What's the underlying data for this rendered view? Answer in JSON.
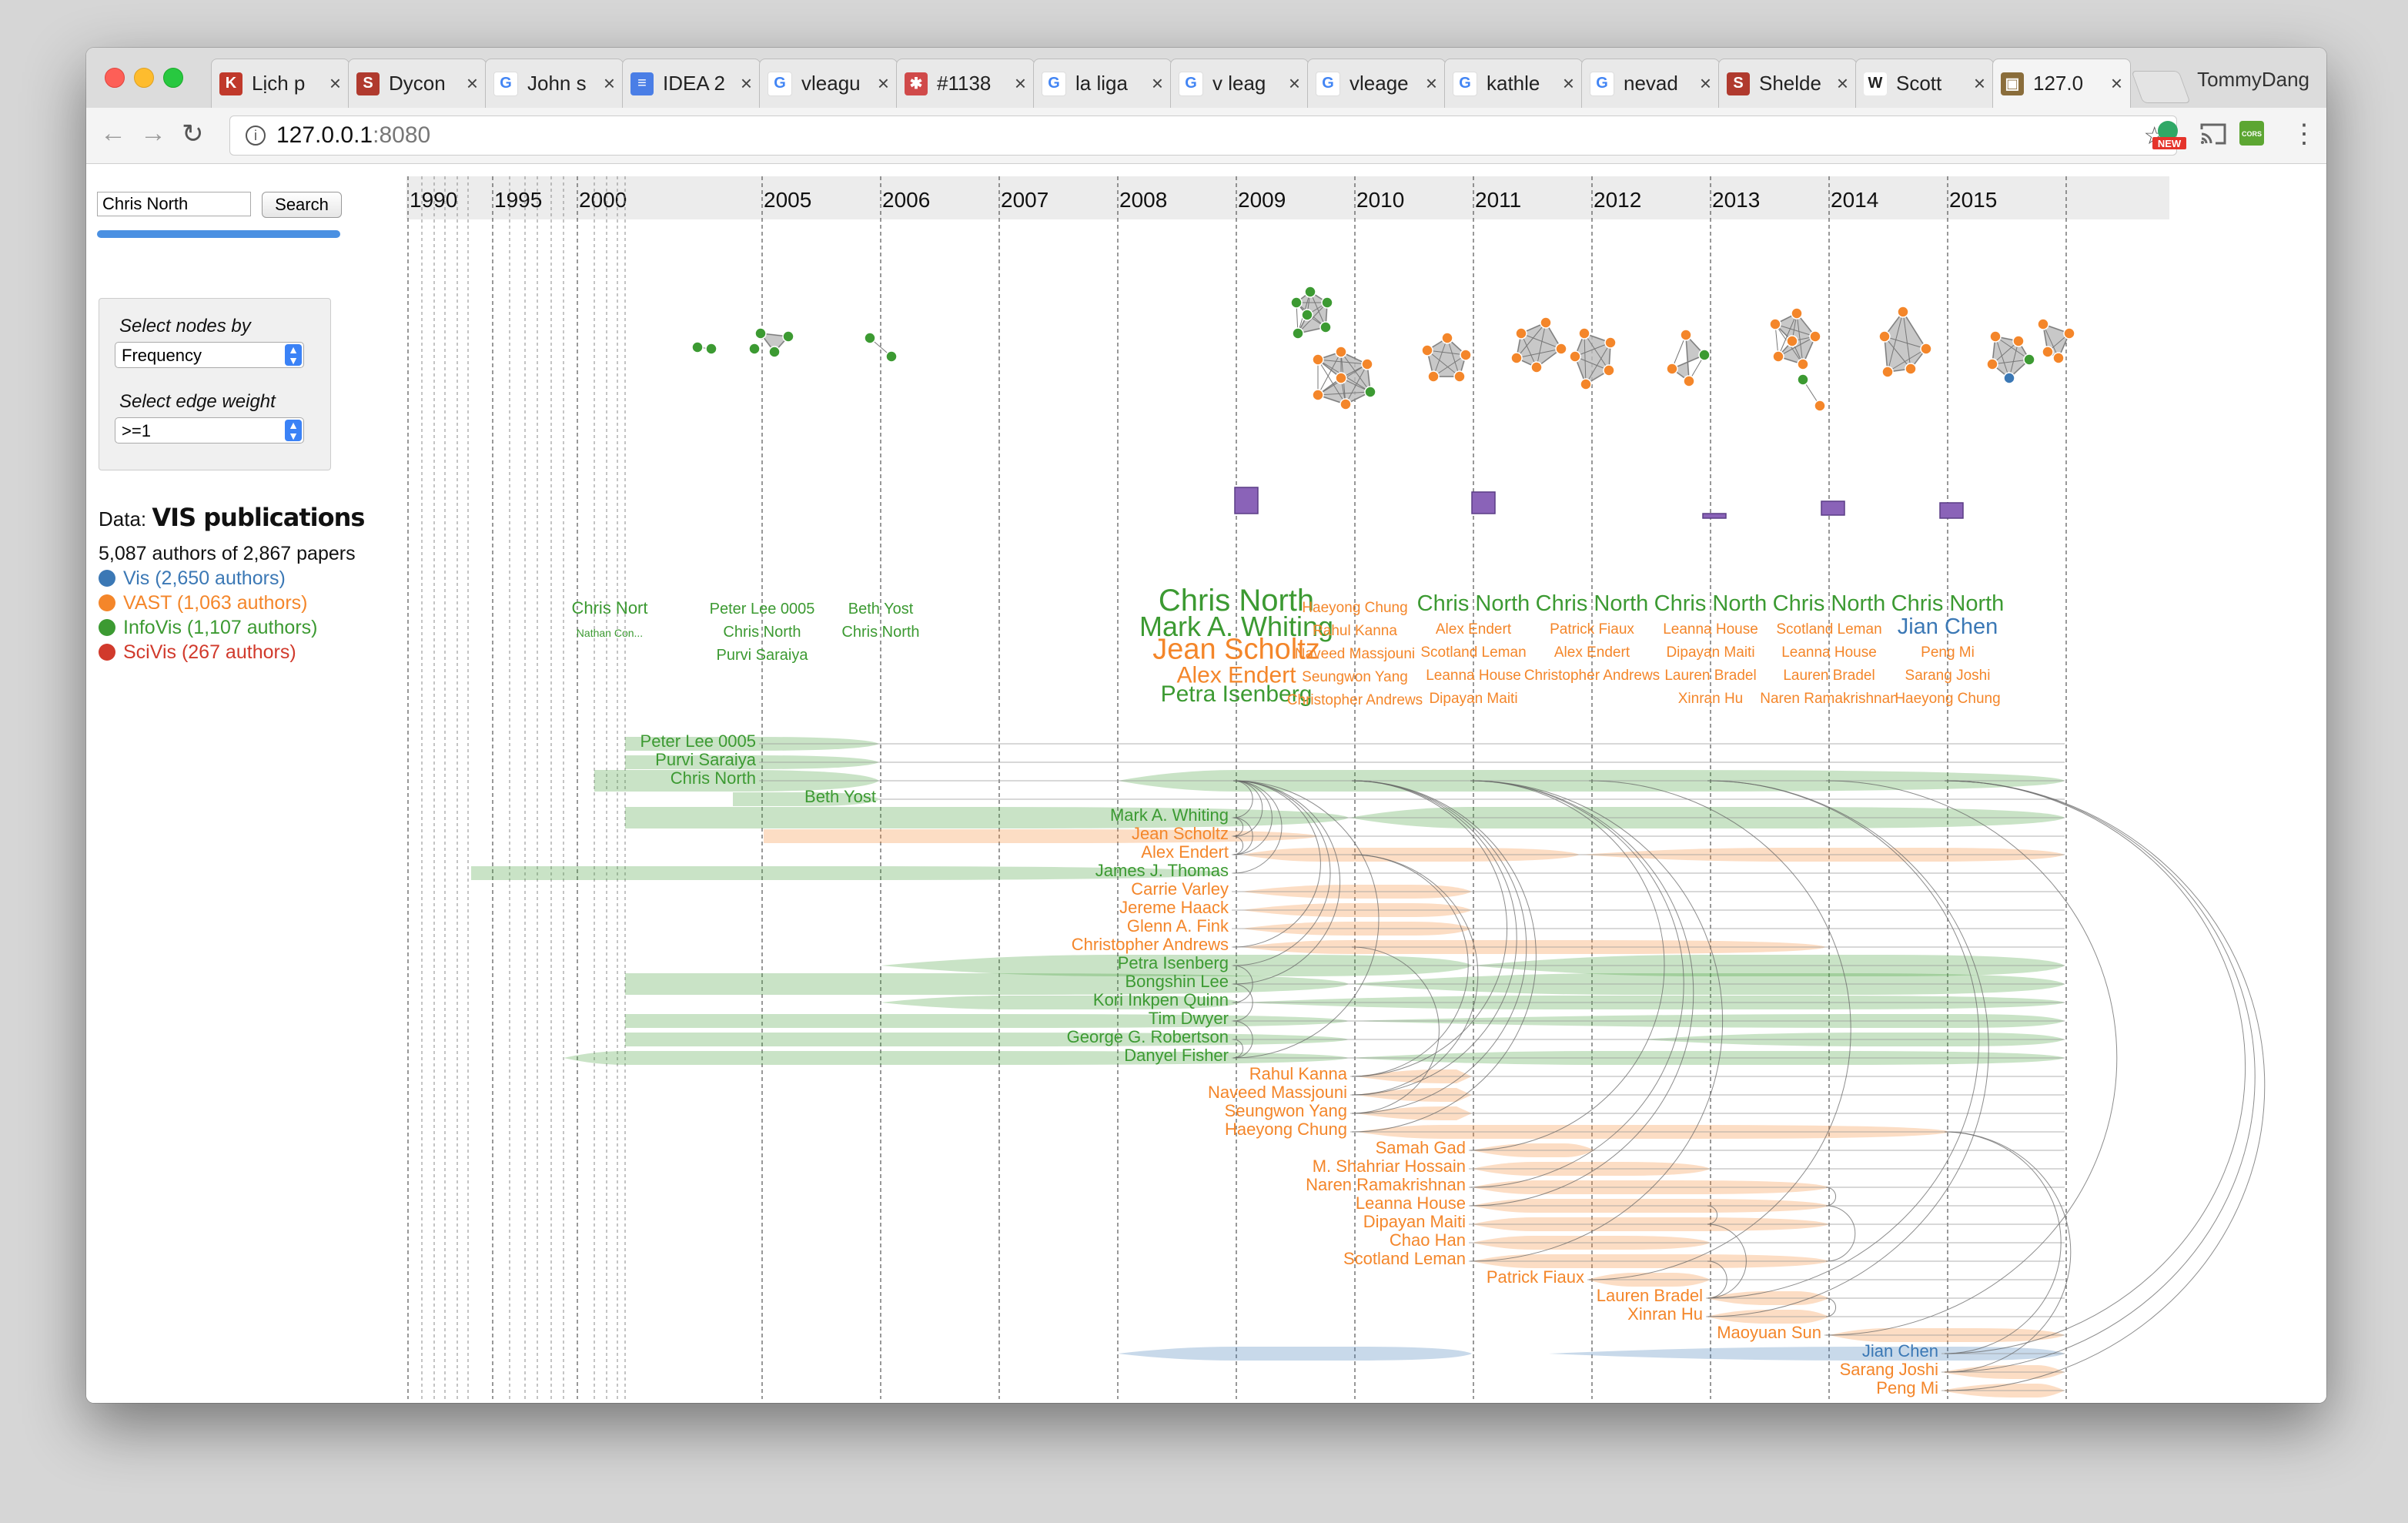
{
  "browser": {
    "profile_name": "TommyDang",
    "tabs": [
      {
        "label": "Lịch p",
        "icon": "k-news-icon",
        "color": "#c0392b"
      },
      {
        "label": "Dycon",
        "icon": "s-icon",
        "color": "#b03a2e"
      },
      {
        "label": "John s",
        "icon": "google-icon",
        "color": "#4285f4"
      },
      {
        "label": "IDEA 2",
        "icon": "docs-icon",
        "color": "#4a7ee6"
      },
      {
        "label": "vleagu",
        "icon": "google-icon",
        "color": "#4285f4"
      },
      {
        "label": "#1138",
        "icon": "slack-icon",
        "color": "#d04a4a"
      },
      {
        "label": "la liga",
        "icon": "google-icon",
        "color": "#4285f4"
      },
      {
        "label": "v leag",
        "icon": "google-icon",
        "color": "#4285f4"
      },
      {
        "label": "vleage",
        "icon": "google-icon",
        "color": "#4285f4"
      },
      {
        "label": "kathle",
        "icon": "google-icon",
        "color": "#4285f4"
      },
      {
        "label": "nevad",
        "icon": "google-icon",
        "color": "#4285f4"
      },
      {
        "label": "Shelde",
        "icon": "s-icon",
        "color": "#b03a2e"
      },
      {
        "label": "Scott",
        "icon": "wikipedia-icon",
        "color": "#222222"
      },
      {
        "label": "127.0",
        "icon": "photo-icon",
        "color": "#8a6d3b"
      }
    ],
    "url_host": "127.0.0.1",
    "url_port": ":8080",
    "ext_new_badge": "NEW",
    "ext_cors_badge": "CORS"
  },
  "sidebar": {
    "search_value": "Chris North",
    "search_button": "Search",
    "select_nodes_label": "Select nodes by",
    "select_nodes_value": "Frequency",
    "select_edge_label": "Select edge weight",
    "select_edge_value": ">=1",
    "data_prefix": "Data:",
    "data_name": "VIS publications",
    "counts": "5,087 authors of 2,867 papers",
    "legend": [
      {
        "label": "Vis (2,650 authors)",
        "color": "#3b78b5"
      },
      {
        "label": "VAST (1,063 authors)",
        "color": "#f4862a"
      },
      {
        "label": "InfoVis (1,107 authors)",
        "color": "#3c9a32"
      },
      {
        "label": "SciVis (267 authors)",
        "color": "#d13a2c"
      }
    ]
  },
  "timeline": {
    "years": [
      "1990",
      "1995",
      "2000",
      "2005",
      "2006",
      "2007",
      "2008",
      "2009",
      "2010",
      "2011",
      "2012",
      "2013",
      "2014",
      "2015"
    ],
    "colors": {
      "green": "#3c9a32",
      "orange": "#f4862a",
      "blue": "#3b78b5",
      "purple": "#8a63b8",
      "grey": "#888888"
    },
    "year_clusters": [
      {
        "names": [
          {
            "t": "Chris Nort",
            "c": "green"
          },
          {
            "t": "Nathan Con...",
            "c": "green"
          }
        ]
      },
      {
        "names": [
          {
            "t": "Peter Lee 0005",
            "c": "green"
          },
          {
            "t": "Chris North",
            "c": "green"
          },
          {
            "t": "Purvi Saraiya",
            "c": "green"
          }
        ]
      },
      {
        "names": [
          {
            "t": "Beth Yost",
            "c": "green"
          },
          {
            "t": "Chris North",
            "c": "green"
          }
        ]
      },
      {
        "names": [
          {
            "t": "Chris North",
            "c": "green"
          },
          {
            "t": "Mark A. Whiting",
            "c": "green"
          },
          {
            "t": "Jean Scholtz",
            "c": "orange"
          },
          {
            "t": "Alex Endert",
            "c": "orange"
          },
          {
            "t": "Petra Isenberg",
            "c": "green"
          }
        ]
      },
      {
        "names": [
          {
            "t": "Haeyong Chung",
            "c": "orange"
          },
          {
            "t": "Rahul Kanna",
            "c": "orange"
          },
          {
            "t": "Naveed Massjouni",
            "c": "orange"
          },
          {
            "t": "Seungwon Yang",
            "c": "orange"
          },
          {
            "t": "Christopher Andrews",
            "c": "orange"
          }
        ]
      },
      {
        "names": [
          {
            "t": "Chris North",
            "c": "green"
          },
          {
            "t": "Alex Endert",
            "c": "orange"
          },
          {
            "t": "Scotland Leman",
            "c": "orange"
          },
          {
            "t": "Leanna House",
            "c": "orange"
          },
          {
            "t": "Dipayan Maiti",
            "c": "orange"
          }
        ]
      },
      {
        "names": [
          {
            "t": "Chris North",
            "c": "green"
          },
          {
            "t": "Patrick Fiaux",
            "c": "orange"
          },
          {
            "t": "Alex Endert",
            "c": "orange"
          },
          {
            "t": "Christopher Andrews",
            "c": "orange"
          }
        ]
      },
      {
        "names": [
          {
            "t": "Chris North",
            "c": "green"
          },
          {
            "t": "Leanna House",
            "c": "orange"
          },
          {
            "t": "Dipayan Maiti",
            "c": "orange"
          },
          {
            "t": "Lauren Bradel",
            "c": "orange"
          },
          {
            "t": "Xinran Hu",
            "c": "orange"
          }
        ]
      },
      {
        "names": [
          {
            "t": "Chris North",
            "c": "green"
          },
          {
            "t": "Scotland Leman",
            "c": "orange"
          },
          {
            "t": "Leanna House",
            "c": "orange"
          },
          {
            "t": "Lauren Bradel",
            "c": "orange"
          },
          {
            "t": "Naren Ramakrishnan",
            "c": "orange"
          }
        ]
      },
      {
        "names": [
          {
            "t": "Chris North",
            "c": "green"
          },
          {
            "t": "Jian Chen",
            "c": "blue"
          },
          {
            "t": "Peng Mi",
            "c": "orange"
          },
          {
            "t": "Sarang Joshi",
            "c": "orange"
          },
          {
            "t": "Haeyong Chung",
            "c": "orange"
          }
        ]
      }
    ],
    "authors": [
      {
        "name": "Peter Lee 0005",
        "c": "green"
      },
      {
        "name": "Purvi Saraiya",
        "c": "green"
      },
      {
        "name": "Chris North",
        "c": "green"
      },
      {
        "name": "Beth Yost",
        "c": "green"
      },
      {
        "name": "Mark A. Whiting",
        "c": "green"
      },
      {
        "name": "Jean Scholtz",
        "c": "orange"
      },
      {
        "name": "Alex Endert",
        "c": "orange"
      },
      {
        "name": "James J. Thomas",
        "c": "green"
      },
      {
        "name": "Carrie Varley",
        "c": "orange"
      },
      {
        "name": "Jereme Haack",
        "c": "orange"
      },
      {
        "name": "Glenn A. Fink",
        "c": "orange"
      },
      {
        "name": "Christopher Andrews",
        "c": "orange"
      },
      {
        "name": "Petra Isenberg",
        "c": "green"
      },
      {
        "name": "Bongshin Lee",
        "c": "green"
      },
      {
        "name": "Kori Inkpen Quinn",
        "c": "green"
      },
      {
        "name": "Tim Dwyer",
        "c": "green"
      },
      {
        "name": "George G. Robertson",
        "c": "green"
      },
      {
        "name": "Danyel Fisher",
        "c": "green"
      },
      {
        "name": "Rahul Kanna",
        "c": "orange"
      },
      {
        "name": "Naveed Massjouni",
        "c": "orange"
      },
      {
        "name": "Seungwon Yang",
        "c": "orange"
      },
      {
        "name": "Haeyong Chung",
        "c": "orange"
      },
      {
        "name": "Samah Gad",
        "c": "orange"
      },
      {
        "name": "M. Shahriar Hossain",
        "c": "orange"
      },
      {
        "name": "Naren Ramakrishnan",
        "c": "orange"
      },
      {
        "name": "Leanna House",
        "c": "orange"
      },
      {
        "name": "Dipayan Maiti",
        "c": "orange"
      },
      {
        "name": "Chao Han",
        "c": "orange"
      },
      {
        "name": "Scotland Leman",
        "c": "orange"
      },
      {
        "name": "Patrick Fiaux",
        "c": "orange"
      },
      {
        "name": "Lauren Bradel",
        "c": "orange"
      },
      {
        "name": "Xinran Hu",
        "c": "orange"
      },
      {
        "name": "Maoyuan Sun",
        "c": "orange"
      },
      {
        "name": "Jian Chen",
        "c": "blue"
      },
      {
        "name": "Sarang Joshi",
        "c": "orange"
      },
      {
        "name": "Peng Mi",
        "c": "orange"
      }
    ]
  }
}
